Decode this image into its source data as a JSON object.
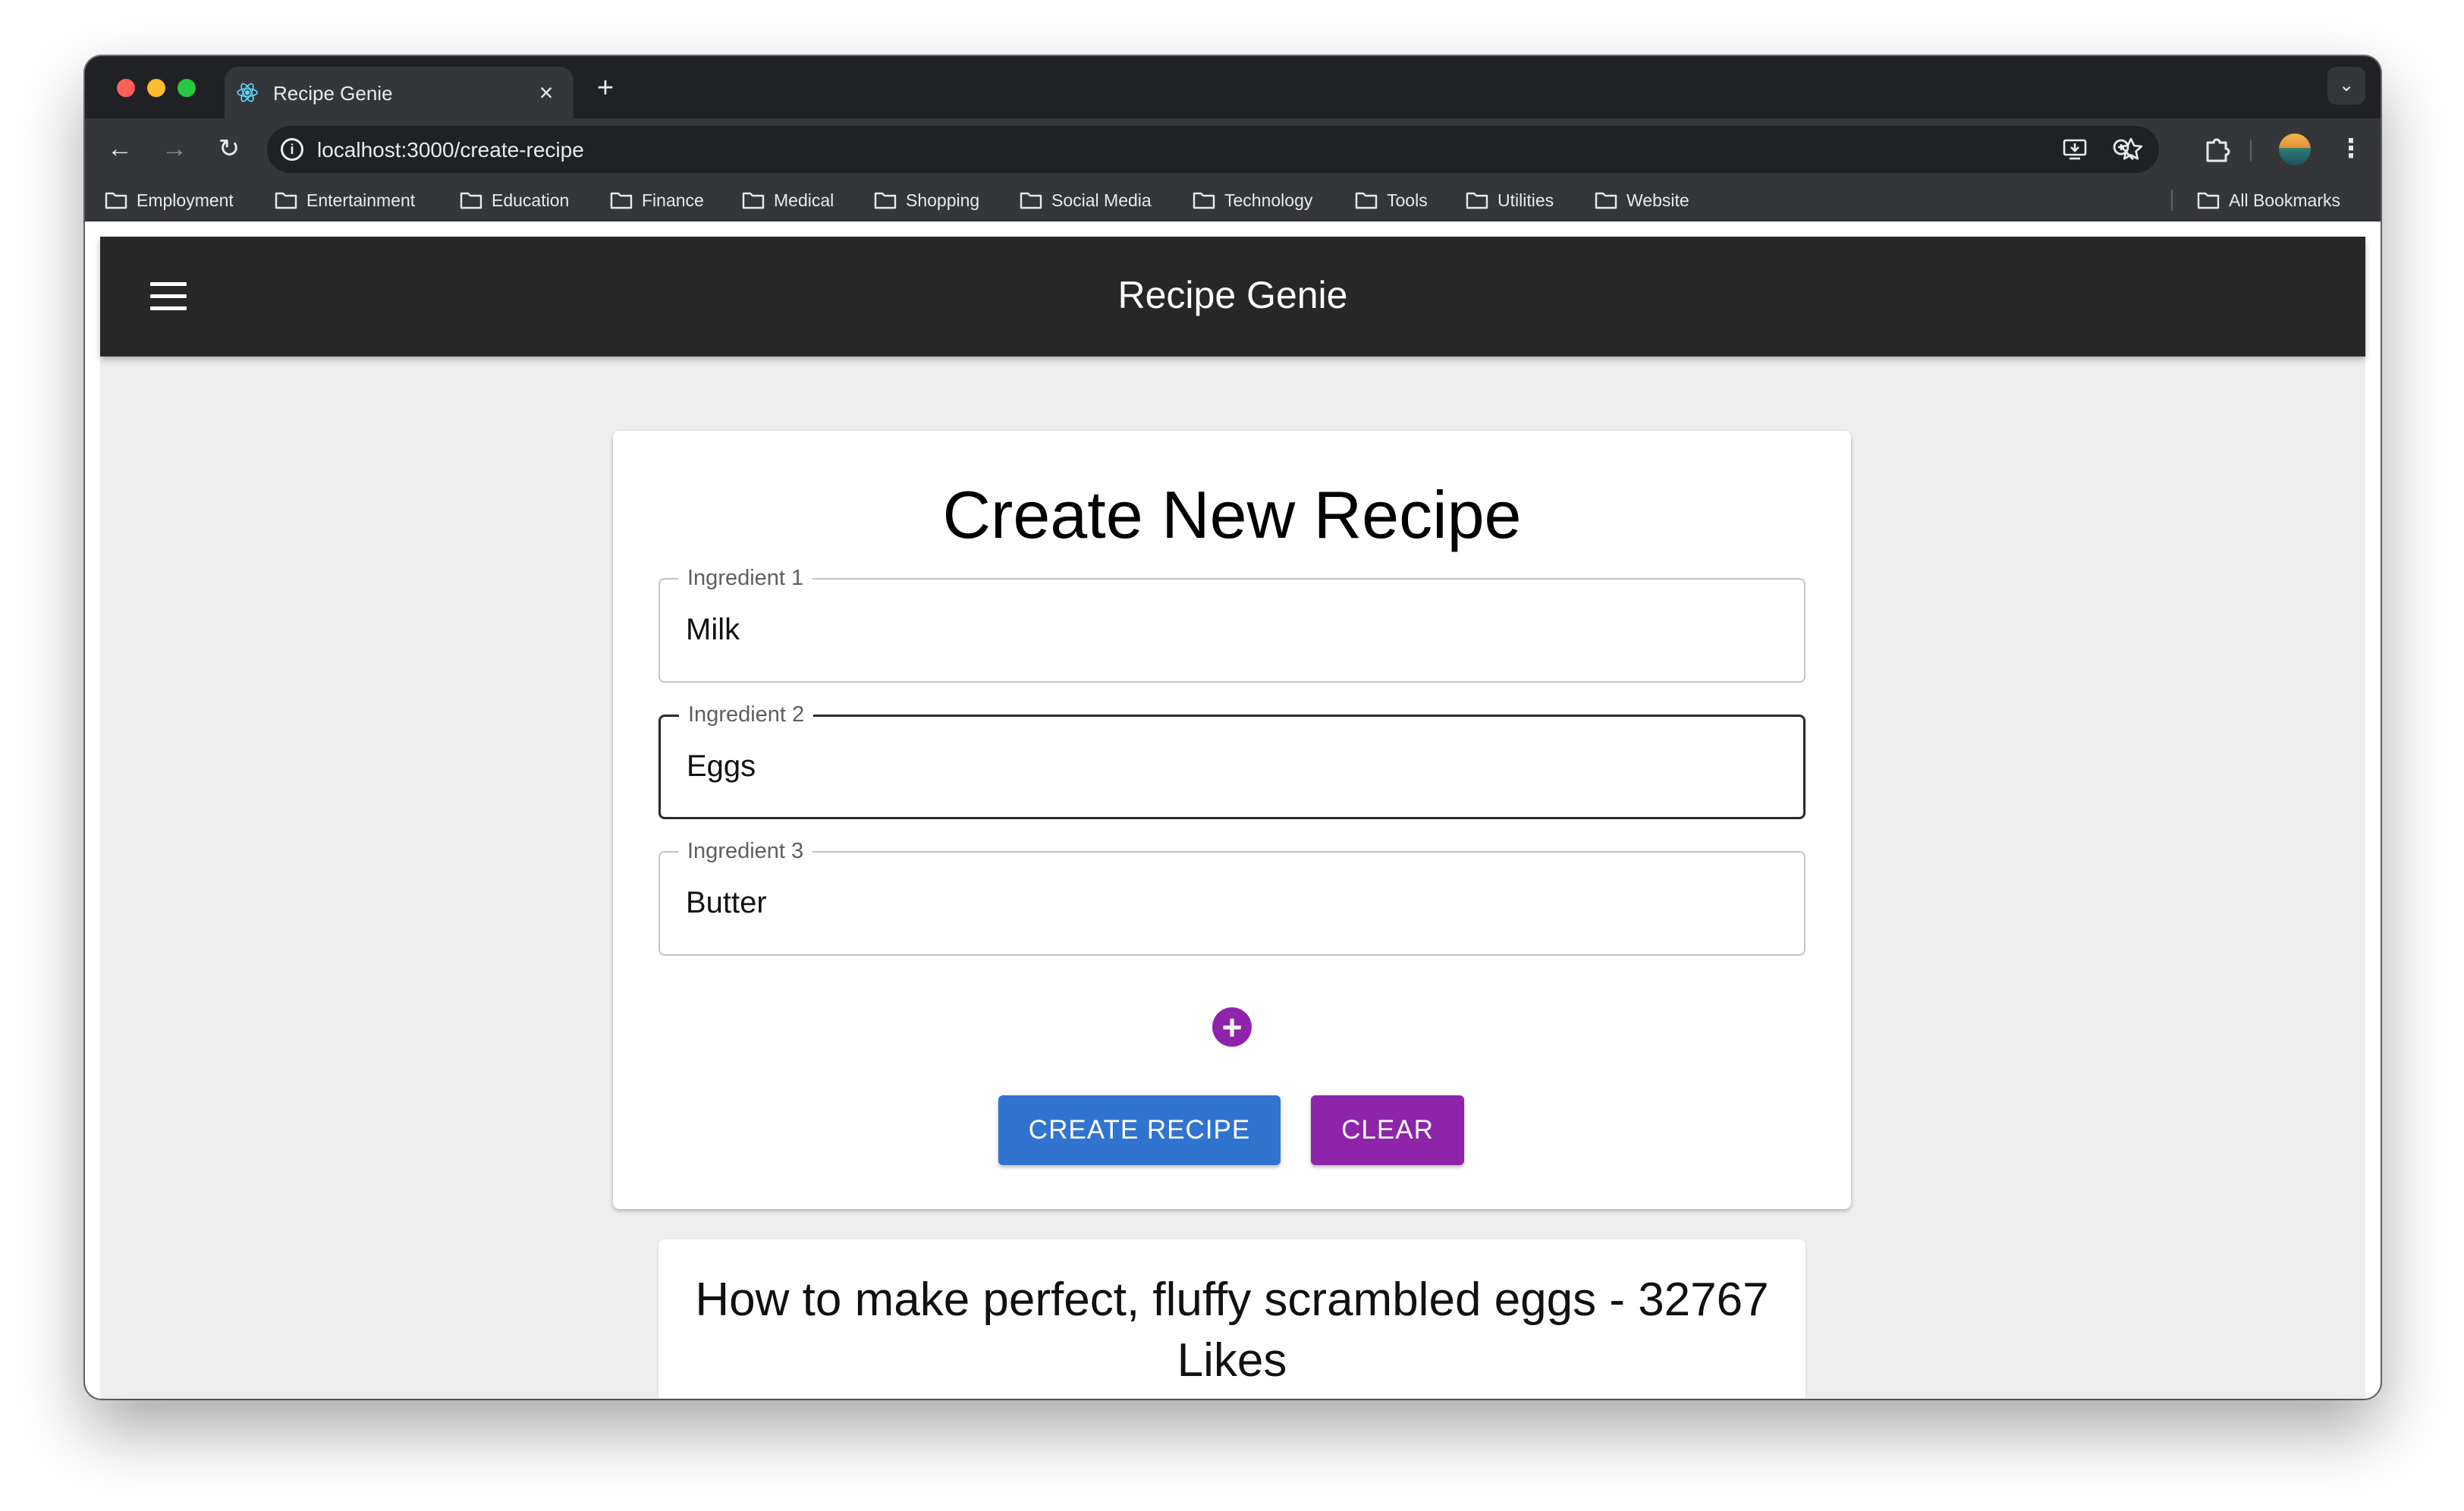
{
  "browser": {
    "tab_title": "Recipe Genie",
    "url": "localhost:3000/create-recipe",
    "bookmarks": [
      "Employment",
      "Entertainment",
      "Education",
      "Finance",
      "Medical",
      "Shopping",
      "Social Media",
      "Technology",
      "Tools",
      "Utilities",
      "Website"
    ],
    "all_bookmarks_label": "All Bookmarks"
  },
  "app": {
    "title": "Recipe Genie"
  },
  "form": {
    "title": "Create New Recipe",
    "ingredients": [
      {
        "label": "Ingredient 1",
        "value": "Milk"
      },
      {
        "label": "Ingredient 2",
        "value": "Eggs",
        "focused": true
      },
      {
        "label": "Ingredient 3",
        "value": "Butter"
      }
    ],
    "add_icon": "plus-circle-icon",
    "create_label": "CREATE RECIPE",
    "clear_label": "CLEAR"
  },
  "results": [
    {
      "title": "How to make perfect, fluffy scrambled eggs - 32767 Likes"
    }
  ],
  "colors": {
    "appbar": "#272727",
    "primary_button": "#3174cf",
    "secondary_button": "#8e24aa"
  }
}
